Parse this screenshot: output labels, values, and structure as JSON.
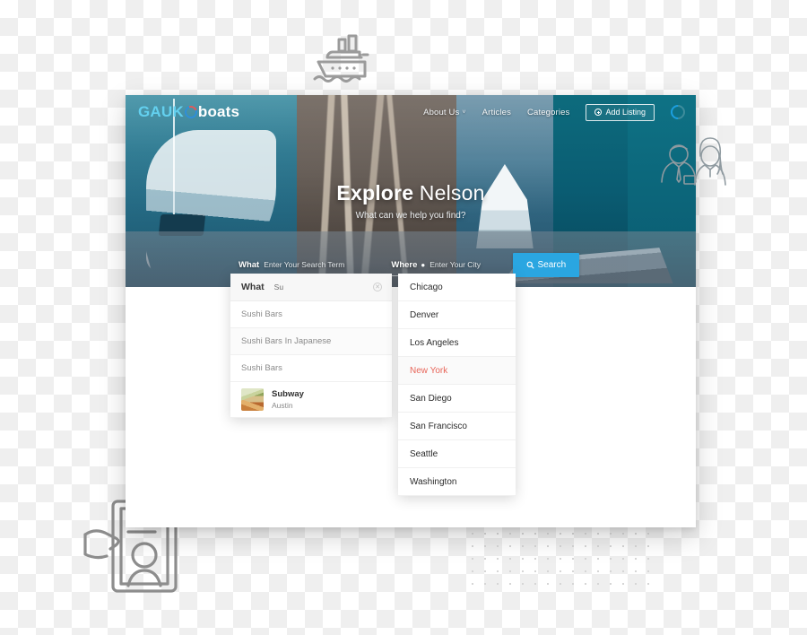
{
  "decor": {
    "boat_icon": "ship-icon",
    "clipboard_icon": "hand-holding-clipboard-icon",
    "people_icon": "two-people-outline-icon",
    "dot_grid": "dot-grid-pattern"
  },
  "site": {
    "logo": {
      "part1": "GAUK",
      "part2": "boats",
      "ring_icon": "ring-icon"
    },
    "nav": [
      {
        "label": "About Us",
        "caret": "˅",
        "has_dropdown": true
      },
      {
        "label": "Articles",
        "has_dropdown": false
      },
      {
        "label": "Categories",
        "has_dropdown": false
      }
    ],
    "add_listing": {
      "label": "Add Listing",
      "icon": "plus-circle-icon"
    },
    "spinner": "loading-spinner-icon"
  },
  "hero": {
    "title_bold": "Explore",
    "title_light": "Nelson",
    "subtitle": "What can we help you find?"
  },
  "search": {
    "what": {
      "label": "What",
      "placeholder": "Enter Your Search Term",
      "value": ""
    },
    "where": {
      "label": "Where",
      "pin_icon": "map-pin-icon",
      "placeholder": "Enter Your City",
      "value": ""
    },
    "button": {
      "label": "Search",
      "icon": "search-icon"
    }
  },
  "what_dropdown": {
    "header": {
      "label": "What",
      "value": "Su",
      "clear_icon": "clear-circle-icon"
    },
    "suggestions": [
      {
        "text": "Sushi Bars"
      },
      {
        "text": "Sushi Bars In Japanese"
      },
      {
        "text": "Sushi Bars"
      }
    ],
    "listing": {
      "title": "Subway",
      "subtitle": "Austin",
      "thumb": "food-thumbnail"
    }
  },
  "where_dropdown": {
    "cities": [
      {
        "name": "Chicago",
        "selected": false
      },
      {
        "name": "Denver",
        "selected": false
      },
      {
        "name": "Los Angeles",
        "selected": false
      },
      {
        "name": "New York",
        "selected": true
      },
      {
        "name": "San Diego",
        "selected": false
      },
      {
        "name": "San Francisco",
        "selected": false
      },
      {
        "name": "Seattle",
        "selected": false
      },
      {
        "name": "Washington",
        "selected": false
      }
    ]
  },
  "colors": {
    "accent_blue": "#2aa6e1",
    "logo_blue": "#63d0ef",
    "selected_red": "#e8665a",
    "teal_panel": "#0d6b7d",
    "checker_gray": "#efefef"
  }
}
